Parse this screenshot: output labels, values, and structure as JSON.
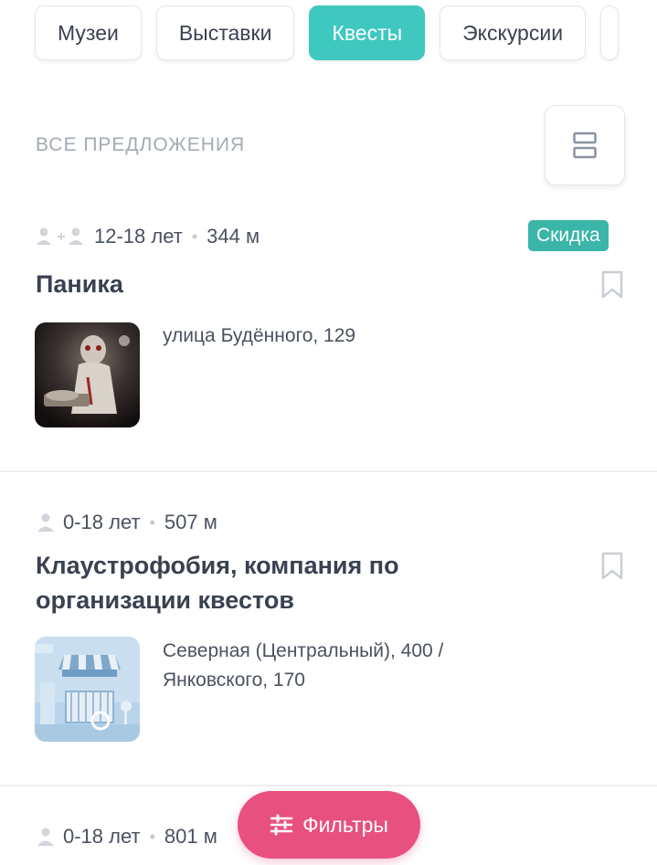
{
  "tabs": [
    {
      "label": "Музеи"
    },
    {
      "label": "Выставки"
    },
    {
      "label": "Квесты",
      "active": true
    },
    {
      "label": "Экскурсии"
    }
  ],
  "section": {
    "title": "ВСЕ ПРЕДЛОЖЕНИЯ"
  },
  "offers": [
    {
      "age": "12-18 лет",
      "distance": "344 м",
      "badge": "Скидка",
      "title": "Паника",
      "address": "улица Будённого, 129",
      "icon": "group-people-icon"
    },
    {
      "age": "0-18 лет",
      "distance": "507 м",
      "title_line1": "Клаустрофобия, компания по",
      "title_line2": "организации квестов",
      "address_line1": "Северная (Центральный), 400 /",
      "address_line2": "Янковского, 170",
      "icon": "person-icon"
    },
    {
      "age": "0-18 лет",
      "distance": "801 м",
      "icon": "person-icon"
    }
  ],
  "filters_button": {
    "label": "Фильтры"
  },
  "colors": {
    "accent_teal": "#3ec8c0",
    "badge_teal": "#3ab5a8",
    "filters_pink": "#e8507f",
    "muted_text": "#a3aab6"
  }
}
